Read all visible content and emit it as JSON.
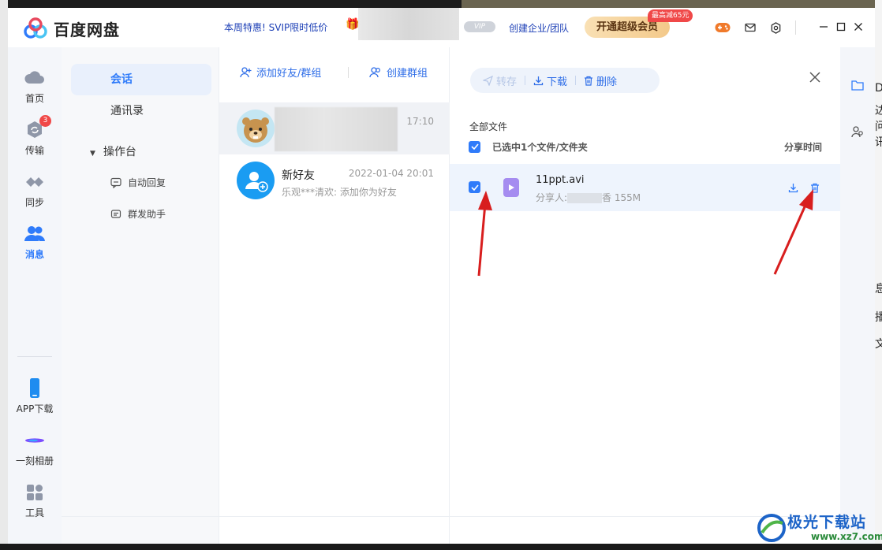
{
  "app": {
    "name": "百度网盘"
  },
  "titlebar": {
    "promo": "本周特惠! SVIP限时低价",
    "vip_badge": "VIP",
    "enterprise": "创建企业/团队",
    "vip_button": "开通超级会员",
    "vip_tag": "最高减65元",
    "icons": [
      "game-controller-icon",
      "mail-icon",
      "settings-icon"
    ],
    "window_controls": [
      "minimize",
      "maximize",
      "close"
    ]
  },
  "nav": {
    "items": [
      {
        "label": "首页",
        "icon": "cloud-icon"
      },
      {
        "label": "传输",
        "icon": "transfer-icon",
        "badge": "3"
      },
      {
        "label": "同步",
        "icon": "sync-icon"
      },
      {
        "label": "消息",
        "icon": "contacts-icon",
        "active": true
      }
    ],
    "bottom": [
      {
        "label": "APP下载",
        "icon": "phone-icon"
      },
      {
        "label": "一刻相册",
        "icon": "album-icon"
      },
      {
        "label": "工具",
        "icon": "tools-icon"
      }
    ]
  },
  "subnav": {
    "chat": "会话",
    "contacts": "通讯录",
    "console": "操作台",
    "auto_reply": "自动回复",
    "mass_send": "群发助手"
  },
  "convlist": {
    "add_friend": "添加好友/群组",
    "create_group": "创建群组",
    "items": [
      {
        "name": "",
        "time": "17:10",
        "message": ""
      },
      {
        "name": "新好友",
        "time": "2022-01-04 20:01",
        "message": "乐观***清欢: 添加你为好友"
      }
    ]
  },
  "filepanel": {
    "toolbar": {
      "save": "转存",
      "download": "下载",
      "delete": "删除"
    },
    "breadcrumb": "全部文件",
    "selected_summary": "已选中1个文件/文件夹",
    "col_share_time": "分享时间",
    "files": [
      {
        "name": "11ppt.avi",
        "sharer_label": "分享人:",
        "sharer_tail": "香",
        "size": "155M",
        "checked": true
      }
    ]
  },
  "watermark": {
    "text": "极光下载站",
    "url": "www.xz7.com"
  },
  "colors": {
    "accent": "#2f7bfa",
    "link": "#1c3fb6",
    "badge": "#f04848",
    "arrow": "#d81e1e"
  }
}
